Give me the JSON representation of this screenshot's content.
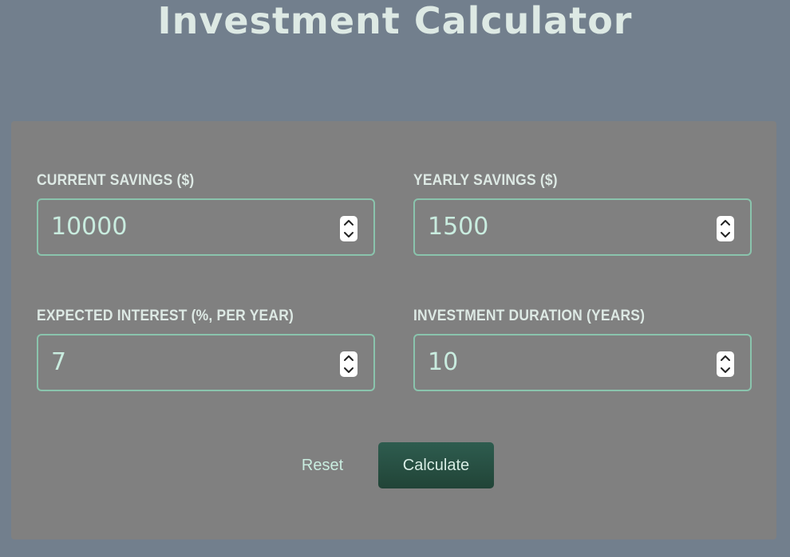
{
  "header": {
    "title": "Investment Calculator"
  },
  "form": {
    "fields": [
      {
        "label": "CURRENT SAVINGS ($)",
        "value": "10000"
      },
      {
        "label": "YEARLY SAVINGS ($)",
        "value": "1500"
      },
      {
        "label": "EXPECTED INTEREST (%, PER YEAR)",
        "value": "7"
      },
      {
        "label": "INVESTMENT DURATION (YEARS)",
        "value": "10"
      }
    ],
    "actions": {
      "reset_label": "Reset",
      "calculate_label": "Calculate"
    }
  },
  "colors": {
    "page_background": "#727f8d",
    "card_background": "#808080",
    "title_text": "#dde9e4",
    "input_border": "#8ac4ad",
    "input_text": "#c9ecdf",
    "primary_button": "#2a5548"
  },
  "icons": {
    "stepper_up": "chevron-up-icon",
    "stepper_down": "chevron-down-icon"
  }
}
